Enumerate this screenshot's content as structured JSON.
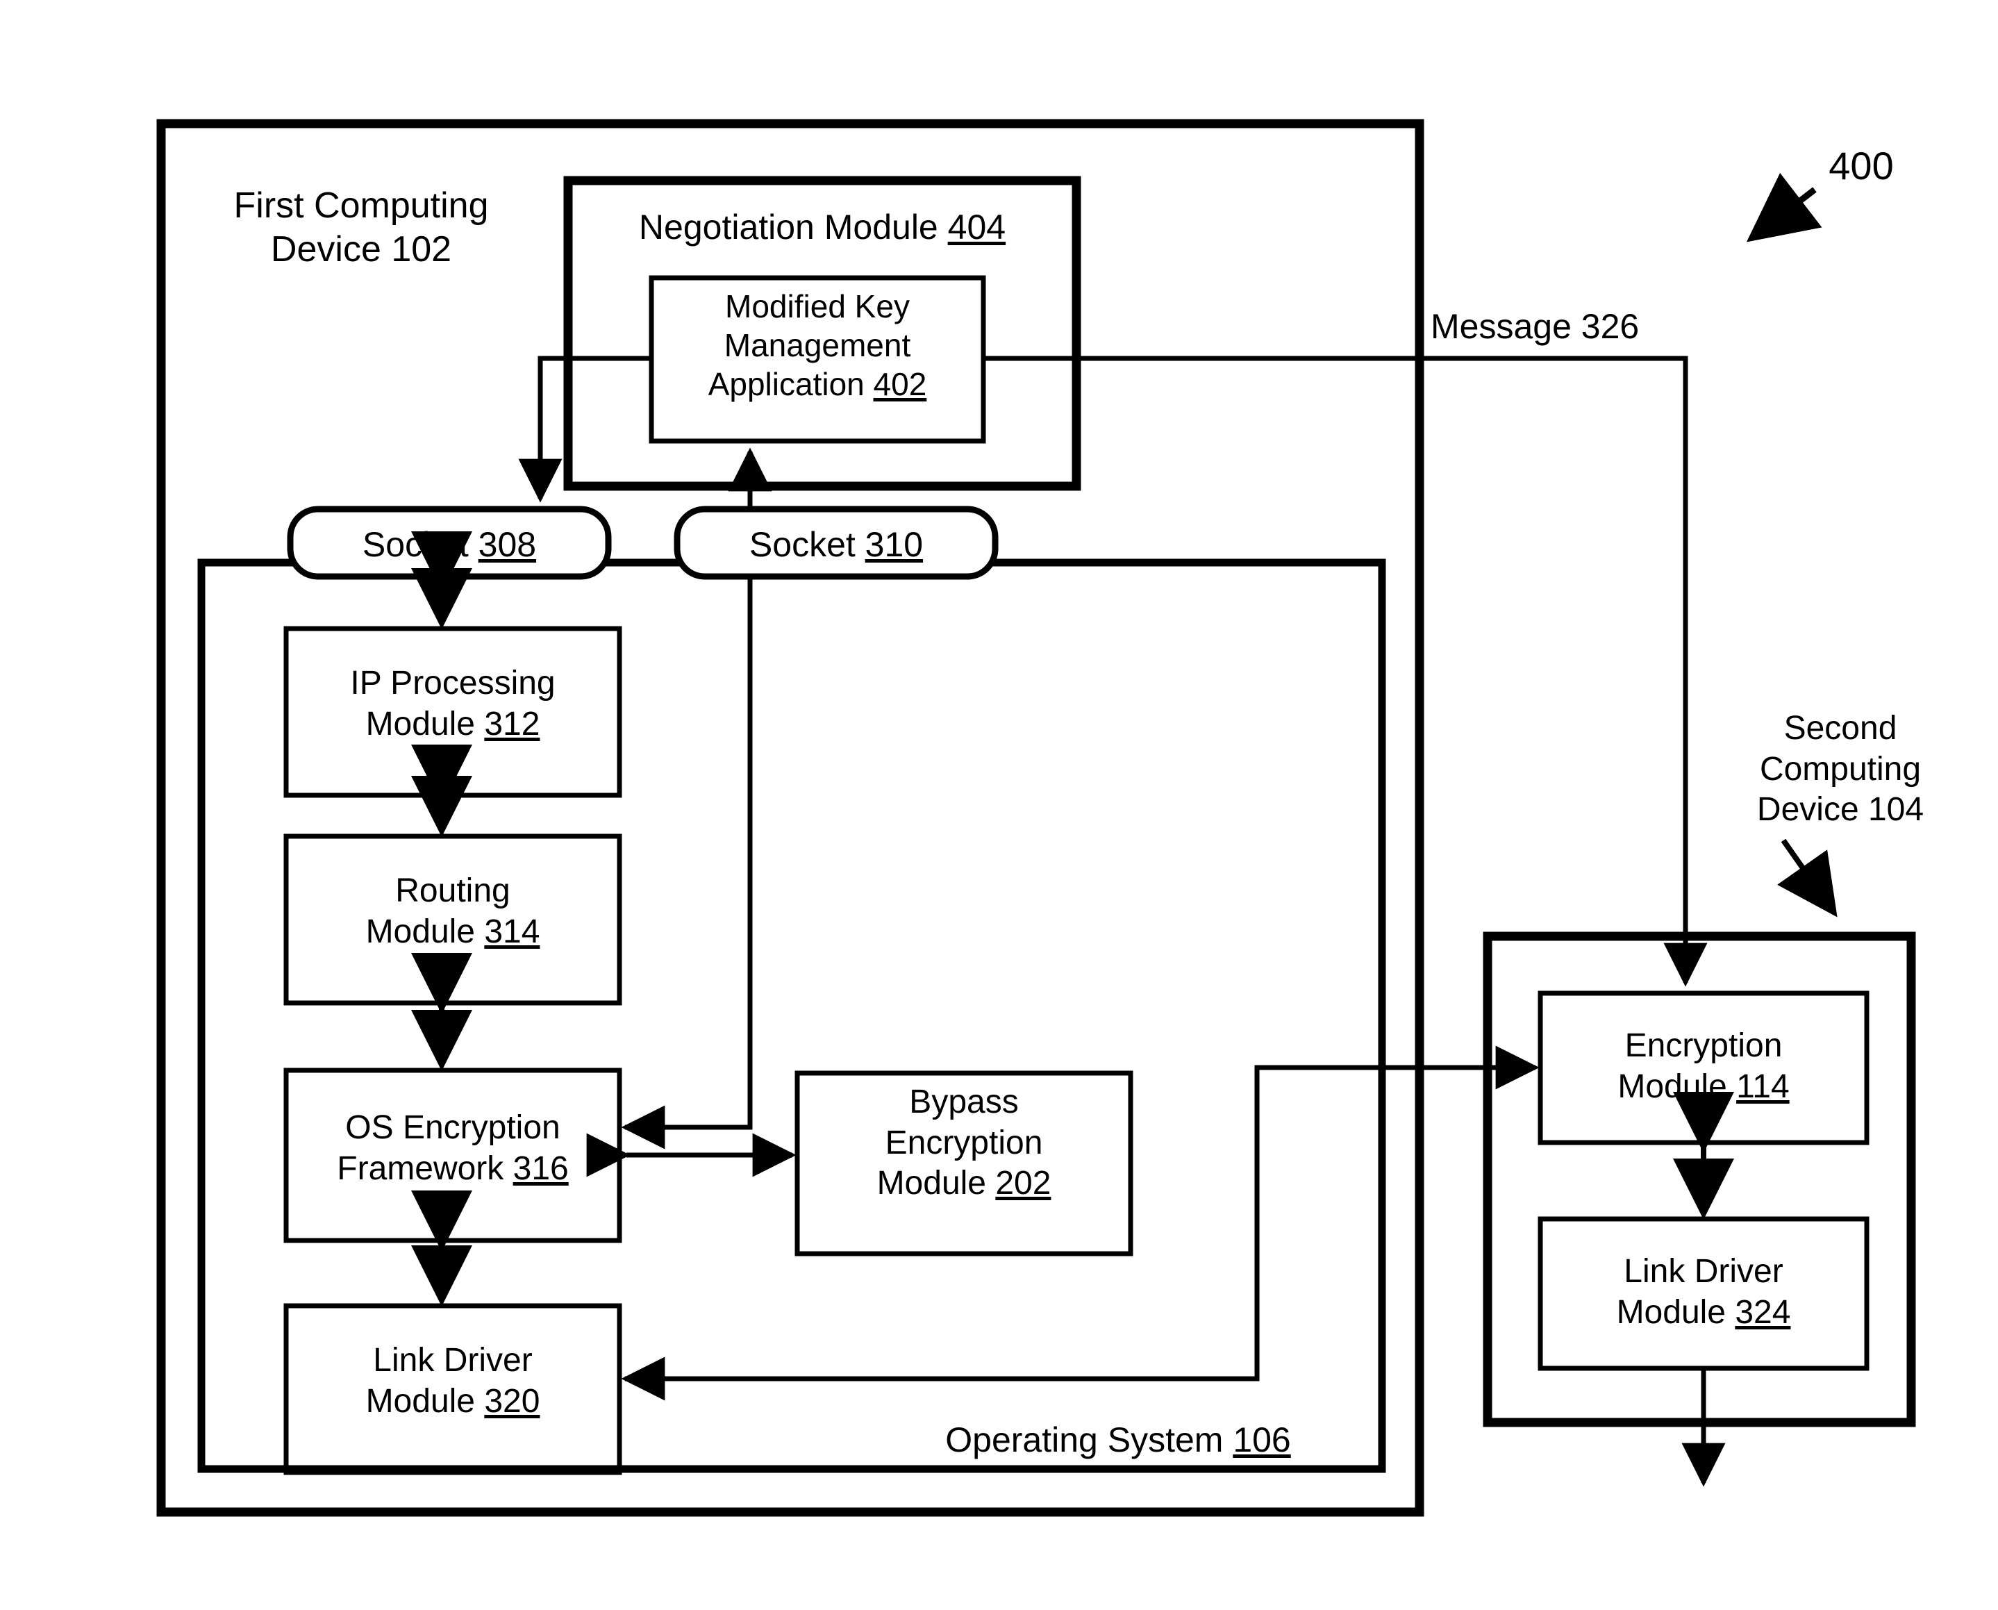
{
  "figure": {
    "number": "400",
    "domain": "patent-block-diagram"
  },
  "first_device": {
    "label_line1": "First Computing",
    "label_line2": "Device 102",
    "ref": "102"
  },
  "operating_system": {
    "label": "Operating System ",
    "ref": "106"
  },
  "negotiation_module": {
    "label": "Negotiation Module ",
    "ref": "404"
  },
  "key_mgmt_app": {
    "line1": "Modified Key",
    "line2": "Management",
    "line3": "Application ",
    "ref": "402"
  },
  "socket_308": {
    "label": "Socket ",
    "ref": "308"
  },
  "socket_310": {
    "label": "Socket ",
    "ref": "310"
  },
  "ip_processing": {
    "line1": "IP Processing",
    "line2": "Module ",
    "ref": "312"
  },
  "routing": {
    "line1": "Routing",
    "line2": "Module ",
    "ref": "314"
  },
  "os_encryption": {
    "line1": "OS Encryption",
    "line2": "Framework ",
    "ref": "316"
  },
  "link_driver_320": {
    "line1": "Link Driver",
    "line2": "Module ",
    "ref": "320"
  },
  "bypass_encryption": {
    "line1": "Bypass",
    "line2": "Encryption",
    "line3": "Module ",
    "ref": "202"
  },
  "message": {
    "label": "Message 326"
  },
  "second_device": {
    "label_line1": "Second",
    "label_line2": "Computing",
    "label_line3": "Device 104",
    "ref": "104"
  },
  "encryption_module_114": {
    "line1": "Encryption",
    "line2": "Module ",
    "ref": "114"
  },
  "link_driver_324": {
    "line1": "Link Driver",
    "line2": "Module ",
    "ref": "324"
  },
  "colors": {
    "stroke": "#000000",
    "background": "#ffffff"
  }
}
